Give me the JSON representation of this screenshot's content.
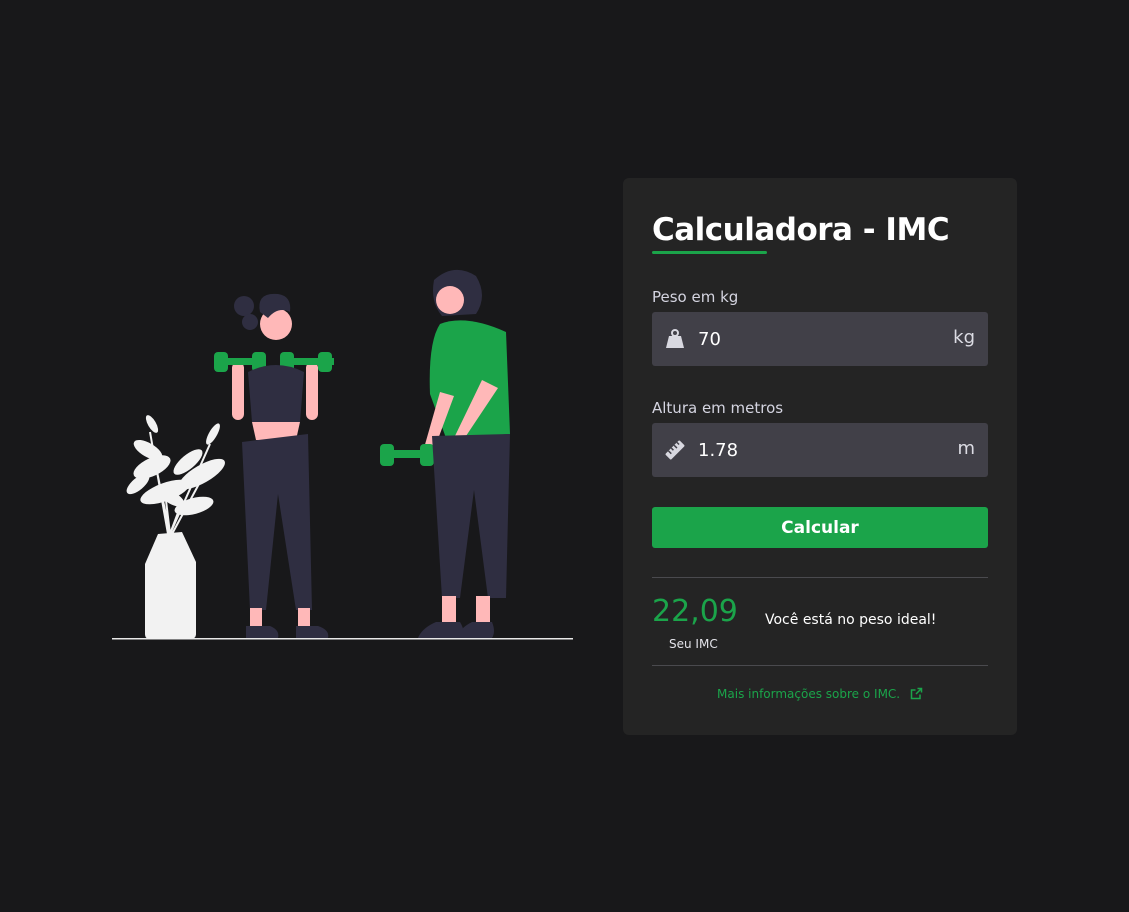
{
  "app": {
    "title": "Calculadora - IMC",
    "accent_color": "#1ba44a",
    "background_color": "#18181a",
    "card_color": "#242424"
  },
  "illustration": {
    "icon": "fitness-people-illustration"
  },
  "weight": {
    "label": "Peso em kg",
    "value": "70",
    "unit": "kg",
    "icon": "weight-icon"
  },
  "height": {
    "label": "Altura em metros",
    "value": "1.78",
    "unit": "m",
    "icon": "ruler-icon"
  },
  "actions": {
    "calculate_label": "Calcular"
  },
  "result": {
    "value": "22,09",
    "label": "Seu IMC",
    "message": "Você está no peso ideal!"
  },
  "info": {
    "link_text": "Mais informações sobre o IMC.",
    "icon": "external-link-icon"
  }
}
